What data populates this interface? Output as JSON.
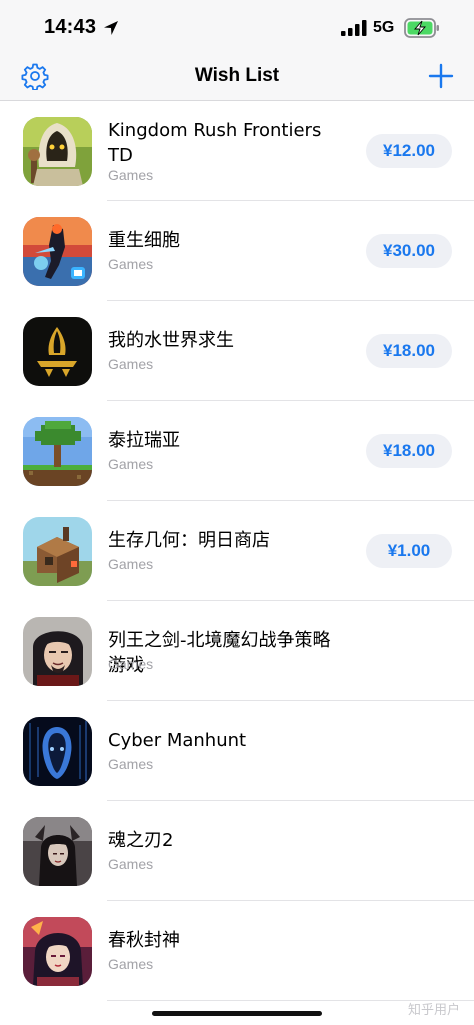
{
  "status_bar": {
    "time": "14:43",
    "network": "5G",
    "icons": [
      "location-arrow-icon",
      "cellular-signal-icon",
      "battery-charging-icon"
    ],
    "battery_color": "#4cd964"
  },
  "nav": {
    "title": "Wish List",
    "left_icon": "gear-icon",
    "right_icon": "plus-icon",
    "accent": "#1a78ee"
  },
  "apps": [
    {
      "name": "Kingdom Rush Frontiers TD",
      "category": "Games",
      "price": "¥12.00",
      "icon": "kingdom-rush-icon"
    },
    {
      "name": "重生细胞",
      "category": "Games",
      "price": "¥30.00",
      "icon": "dead-cells-icon"
    },
    {
      "name": "我的水世界求生",
      "category": "Games",
      "price": "¥18.00",
      "icon": "water-world-icon"
    },
    {
      "name": "泰拉瑞亚",
      "category": "Games",
      "price": "¥18.00",
      "icon": "terraria-icon"
    },
    {
      "name": "生存几何：明日商店",
      "category": "Games",
      "price": "¥1.00",
      "icon": "survival-geometry-icon"
    },
    {
      "name": "列王之剑-北境魔幻战争策略游戏",
      "category": "Games",
      "price": "",
      "icon": "sword-of-kings-icon"
    },
    {
      "name": "Cyber Manhunt",
      "category": "Games",
      "price": "",
      "icon": "cyber-manhunt-icon"
    },
    {
      "name": "魂之刃2",
      "category": "Games",
      "price": "",
      "icon": "soul-blade-icon"
    },
    {
      "name": "春秋封神",
      "category": "Games",
      "price": "",
      "icon": "chunqiu-fengshen-icon"
    }
  ],
  "watermark": "知乎用户"
}
